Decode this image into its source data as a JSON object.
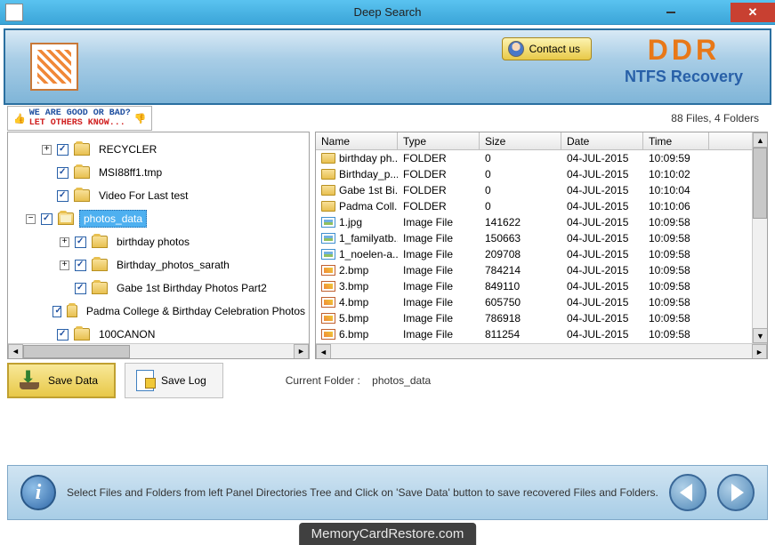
{
  "window": {
    "title": "Deep Search"
  },
  "banner": {
    "contact": "Contact us",
    "brand_top": "DDR",
    "brand_bottom": "NTFS Recovery"
  },
  "feedback": {
    "line1": "WE ARE GOOD OR BAD?",
    "line2": "LET OTHERS KNOW..."
  },
  "counts": "88 Files, 4 Folders",
  "tree": [
    {
      "indent": 38,
      "expander": "+",
      "label": "RECYCLER",
      "selected": false
    },
    {
      "indent": 38,
      "expander": "",
      "label": "MSI88ff1.tmp",
      "selected": false
    },
    {
      "indent": 38,
      "expander": "",
      "label": "Video For Last test",
      "selected": false
    },
    {
      "indent": 20,
      "expander": "−",
      "label": "photos_data",
      "selected": true,
      "open": true
    },
    {
      "indent": 58,
      "expander": "+",
      "label": "birthday photos",
      "selected": false
    },
    {
      "indent": 58,
      "expander": "+",
      "label": "Birthday_photos_sarath",
      "selected": false
    },
    {
      "indent": 58,
      "expander": "",
      "label": "Gabe 1st Birthday Photos Part2",
      "selected": false
    },
    {
      "indent": 58,
      "expander": "",
      "label": "Padma College & Birthday Celebration Photos",
      "selected": false
    },
    {
      "indent": 38,
      "expander": "",
      "label": "100CANON",
      "selected": false
    }
  ],
  "list": {
    "columns": [
      {
        "key": "name",
        "label": "Name",
        "width": 92
      },
      {
        "key": "type",
        "label": "Type",
        "width": 92
      },
      {
        "key": "size",
        "label": "Size",
        "width": 92
      },
      {
        "key": "date",
        "label": "Date",
        "width": 92
      },
      {
        "key": "time",
        "label": "Time",
        "width": 74
      }
    ],
    "rows": [
      {
        "icon": "folder",
        "name": "birthday ph...",
        "type": "FOLDER",
        "size": "0",
        "date": "04-JUL-2015",
        "time": "10:09:59"
      },
      {
        "icon": "folder",
        "name": "Birthday_p...",
        "type": "FOLDER",
        "size": "0",
        "date": "04-JUL-2015",
        "time": "10:10:02"
      },
      {
        "icon": "folder",
        "name": "Gabe 1st Bi...",
        "type": "FOLDER",
        "size": "0",
        "date": "04-JUL-2015",
        "time": "10:10:04"
      },
      {
        "icon": "folder",
        "name": "Padma Coll...",
        "type": "FOLDER",
        "size": "0",
        "date": "04-JUL-2015",
        "time": "10:10:06"
      },
      {
        "icon": "jpg",
        "name": "1.jpg",
        "type": "Image File",
        "size": "141622",
        "date": "04-JUL-2015",
        "time": "10:09:58"
      },
      {
        "icon": "jpg",
        "name": "1_familyatb...",
        "type": "Image File",
        "size": "150663",
        "date": "04-JUL-2015",
        "time": "10:09:58"
      },
      {
        "icon": "jpg",
        "name": "1_noelen-a...",
        "type": "Image File",
        "size": "209708",
        "date": "04-JUL-2015",
        "time": "10:09:58"
      },
      {
        "icon": "bmp",
        "name": "2.bmp",
        "type": "Image File",
        "size": "784214",
        "date": "04-JUL-2015",
        "time": "10:09:58"
      },
      {
        "icon": "bmp",
        "name": "3.bmp",
        "type": "Image File",
        "size": "849110",
        "date": "04-JUL-2015",
        "time": "10:09:58"
      },
      {
        "icon": "bmp",
        "name": "4.bmp",
        "type": "Image File",
        "size": "605750",
        "date": "04-JUL-2015",
        "time": "10:09:58"
      },
      {
        "icon": "bmp",
        "name": "5.bmp",
        "type": "Image File",
        "size": "786918",
        "date": "04-JUL-2015",
        "time": "10:09:58"
      },
      {
        "icon": "bmp",
        "name": "6.bmp",
        "type": "Image File",
        "size": "811254",
        "date": "04-JUL-2015",
        "time": "10:09:58"
      }
    ]
  },
  "actions": {
    "save_data": "Save Data",
    "save_log": "Save Log",
    "current_folder_label": "Current Folder :",
    "current_folder_value": "photos_data"
  },
  "footer": {
    "text": "Select Files and Folders from left Panel Directories Tree and Click on 'Save Data' button to save recovered Files and Folders."
  },
  "watermark": "MemoryCardRestore.com"
}
